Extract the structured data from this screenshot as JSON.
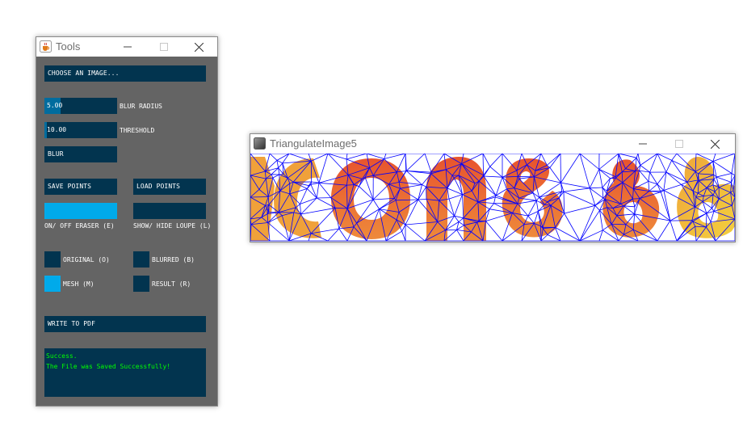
{
  "tools_window": {
    "title": "Tools",
    "choose_image_label": "CHOOSE AN IMAGE...",
    "blur_radius": {
      "value_text": "5.00",
      "label": "BLUR RADIUS",
      "fraction": 0.22
    },
    "threshold": {
      "value_text": "10.00",
      "label": "THRESHOLD",
      "fraction": 0.03
    },
    "blur_button_label": "BLUR",
    "save_points_label": "SAVE POINTS",
    "load_points_label": "LOAD POINTS",
    "eraser_label": "ON/ OFF ERASER (E)",
    "eraser_on": true,
    "loupe_label": "SHOW/ HIDE LOUPE (L)",
    "loupe_on": false,
    "original_label": "ORIGINAL (O)",
    "original_on": false,
    "blurred_label": "BLURRED (B)",
    "blurred_on": false,
    "mesh_label": "MESH (M)",
    "mesh_on": true,
    "result_label": "RESULT (R)",
    "result_on": false,
    "write_pdf_label": "WRITE TO PDF",
    "console_lines": [
      "Success.",
      "The File was Saved Successfully!"
    ]
  },
  "triangulate_window": {
    "title": "TriangulateImage5"
  },
  "colors": {
    "panel_bg": "#646464",
    "control_bg": "#02344f",
    "control_active": "#00aaea",
    "slider_fill": "#016c9e",
    "console_text": "#00ff00",
    "mesh_line": "#0000ff"
  }
}
